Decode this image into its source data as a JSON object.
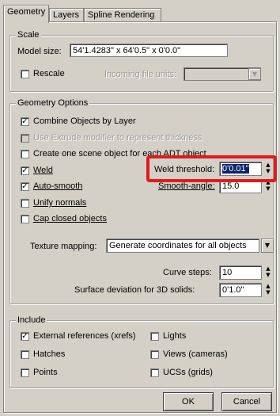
{
  "tabs": [
    "Geometry",
    "Layers",
    "Spline Rendering"
  ],
  "scale": {
    "legend": "Scale",
    "model_size_label": "Model size:",
    "model_size_value": "54'1.4283\" x 64'0.5\" x 0'0.0\"",
    "rescale_label": "Rescale",
    "rescale_checked": false,
    "incoming_units_label": "Incoming file units:",
    "incoming_units_value": ""
  },
  "geometry_options": {
    "legend": "Geometry Options",
    "combine_label": "Combine Objects by Layer",
    "combine_checked": true,
    "extrude_label": "Use Extrude modifier to represent thickness",
    "extrude_checked": false,
    "one_scene_label": "Create one scene object for each ADT object",
    "one_scene_checked": false,
    "weld_label": "Weld",
    "weld_checked": true,
    "weld_threshold_label": "Weld threshold:",
    "weld_threshold_value": "0'0.01\"",
    "autosmooth_label": "Auto-smooth",
    "autosmooth_checked": true,
    "smooth_angle_label": "Smooth-angle:",
    "smooth_angle_value": "15.0",
    "unify_label": "Unify normals",
    "unify_checked": false,
    "cap_label": "Cap closed objects",
    "cap_checked": false,
    "texture_label": "Texture mapping:",
    "texture_value": "Generate coordinates for all objects",
    "curve_steps_label": "Curve steps:",
    "curve_steps_value": "10",
    "surface_dev_label": "Surface deviation for 3D solids:",
    "surface_dev_value": "0'1.0\""
  },
  "include": {
    "legend": "Include",
    "xrefs_label": "External references (xrefs)",
    "xrefs_checked": true,
    "hatches_label": "Hatches",
    "hatches_checked": false,
    "points_label": "Points",
    "points_checked": false,
    "lights_label": "Lights",
    "lights_checked": false,
    "views_label": "Views (cameras)",
    "views_checked": false,
    "ucs_label": "UCSs (grids)",
    "ucs_checked": false
  },
  "buttons": {
    "ok": "OK",
    "cancel": "Cancel"
  },
  "highlight_color": "#e21a1a",
  "selection_color": "#0a246a"
}
